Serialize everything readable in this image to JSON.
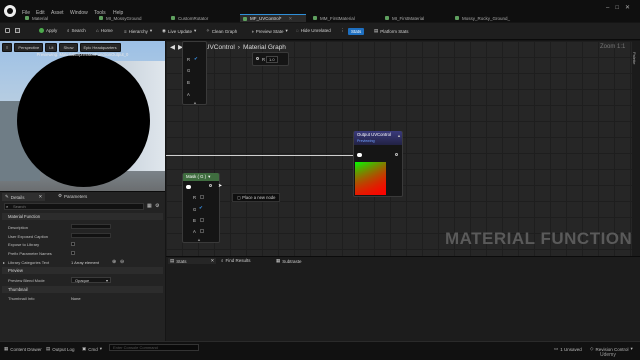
{
  "menu": [
    "File",
    "Edit",
    "Asset",
    "Window",
    "Tools",
    "Help"
  ],
  "tabs": [
    {
      "label": "Material",
      "active": false
    },
    {
      "label": "MI_MossyGround",
      "active": false
    },
    {
      "label": "CustomRotator",
      "active": false
    },
    {
      "label": "MF_UVControl*",
      "active": true
    },
    {
      "label": "MM_FirstMaterial",
      "active": false
    },
    {
      "label": "MI_FirstMaterial",
      "active": false
    },
    {
      "label": "Mossy_Rocky_Ground_",
      "active": false
    }
  ],
  "toolbar": {
    "save": "",
    "apply": "Apply",
    "search": "Search",
    "home": "Home",
    "hierarchy": "Hierarchy",
    "live_update": "Live Update",
    "clean_graph": "Clean Graph",
    "preview_state": "Preview State",
    "hide_unrelated": "Hide Unrelated",
    "stats": "Stats",
    "platform_stats": "Platform Stats"
  },
  "viewport": {
    "buttons": [
      "Perspective",
      "Lit",
      "Show",
      "Epic Headquarters"
    ],
    "caption": "Previewing: MaterialExpressionFunctionOutput_0"
  },
  "details": {
    "tabs": [
      "Details",
      "Parameters"
    ],
    "search_placeholder": "Search",
    "sections": [
      "Material Function",
      "Preview",
      "Thumbnail"
    ],
    "props": [
      {
        "label": "Description",
        "kind": "field"
      },
      {
        "label": "User Exposed Caption",
        "kind": "field"
      },
      {
        "label": "Expose to Library",
        "kind": "check"
      },
      {
        "label": "Prefix Parameter Names",
        "kind": "check"
      },
      {
        "label": "Library Categories Text",
        "kind": "value",
        "value": "1 Array element"
      }
    ],
    "preview_props": [
      {
        "label": "Preview Blend Mode",
        "value": "Opaque"
      }
    ],
    "thumb_props": [
      {
        "label": "Thumbnail Info",
        "value": "None"
      }
    ]
  },
  "graph": {
    "breadcrumb": [
      "MF_UVControl",
      "Material Graph"
    ],
    "zoom": "Zoom 1:1",
    "watermark": "MATERIAL FUNCTION",
    "tooltip": "Place a new node",
    "top_node": {
      "pins": [
        "R",
        "G",
        "B",
        "A"
      ],
      "value_label": "R",
      "value": "1.0"
    },
    "mask_node": {
      "title": "Mask ( G )",
      "pins": [
        "R",
        "G",
        "B",
        "A"
      ]
    },
    "output_node": {
      "title": "Output UVControl",
      "subtitle": "Previewing"
    }
  },
  "bottom": {
    "tabs": [
      "Stats",
      "Find Results",
      "Subtraste"
    ]
  },
  "right_strip": "Palette",
  "statusbar": {
    "content_drawer": "Content Drawer",
    "output_log": "Output Log",
    "cmd": "Cmd",
    "cmd_placeholder": "Enter Console Command",
    "unsaved": "1 Unsaved",
    "revision": "Revision Control"
  },
  "watermark_brand": "Udemy"
}
